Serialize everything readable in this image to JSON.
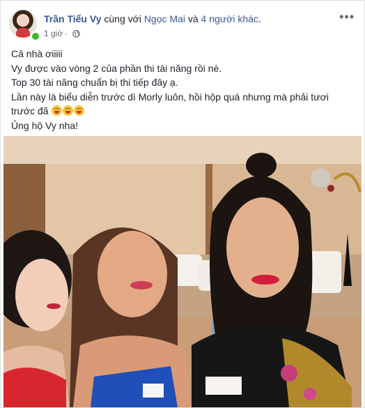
{
  "post": {
    "author": "Trần Tiểu Vy",
    "with_text": "cùng với",
    "tagged_name": "Ngọc Mai",
    "and_text": "và",
    "others": "4 người khác",
    "time": "1 giờ",
    "privacy_icon": "globe-icon",
    "more_icon": "more-options-icon",
    "more_label": "•••",
    "body": [
      "Cả nhà ơiiiii",
      "Vy được vào vòng 2 của phần thi tài năng rồi nè.",
      "Top 30 tài năng chuẩn bị thi tiếp đây ạ.",
      "Lần này là biểu diễn trước dì Morly luôn, hồi hộp quá nhưng mà phải tươi trước đã",
      "Ủng hộ Vy nha!"
    ],
    "emoji_icon": "laughing-face-icon",
    "photo_alt": "Selfie of three contestants"
  },
  "colors": {
    "link": "#385898",
    "text": "#1d2129",
    "meta": "#616770",
    "online": "#42b72a"
  }
}
